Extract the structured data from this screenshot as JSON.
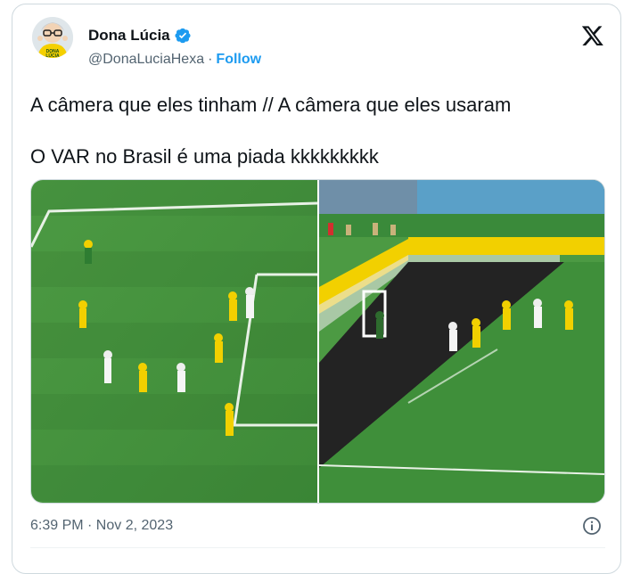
{
  "user": {
    "display_name": "Dona Lúcia",
    "handle": "@DonaLuciaHexa",
    "separator": "·",
    "follow_label": "Follow",
    "avatar_text": "DONA LÚCIA"
  },
  "tweet": {
    "line1": "A câmera que eles tinham // A câmera que eles usaram",
    "line2": "O VAR no Brasil é uma piada kkkkkkkkk"
  },
  "footer": {
    "timestamp": "6:39 PM · Nov 2, 2023"
  },
  "colors": {
    "accent": "#1d9bf0",
    "text": "#0f1419",
    "muted": "#536471",
    "pitch": "#3f8f3a"
  },
  "icons": {
    "verified": "verified-badge-icon",
    "x_logo": "x-logo-icon",
    "info": "info-icon"
  }
}
